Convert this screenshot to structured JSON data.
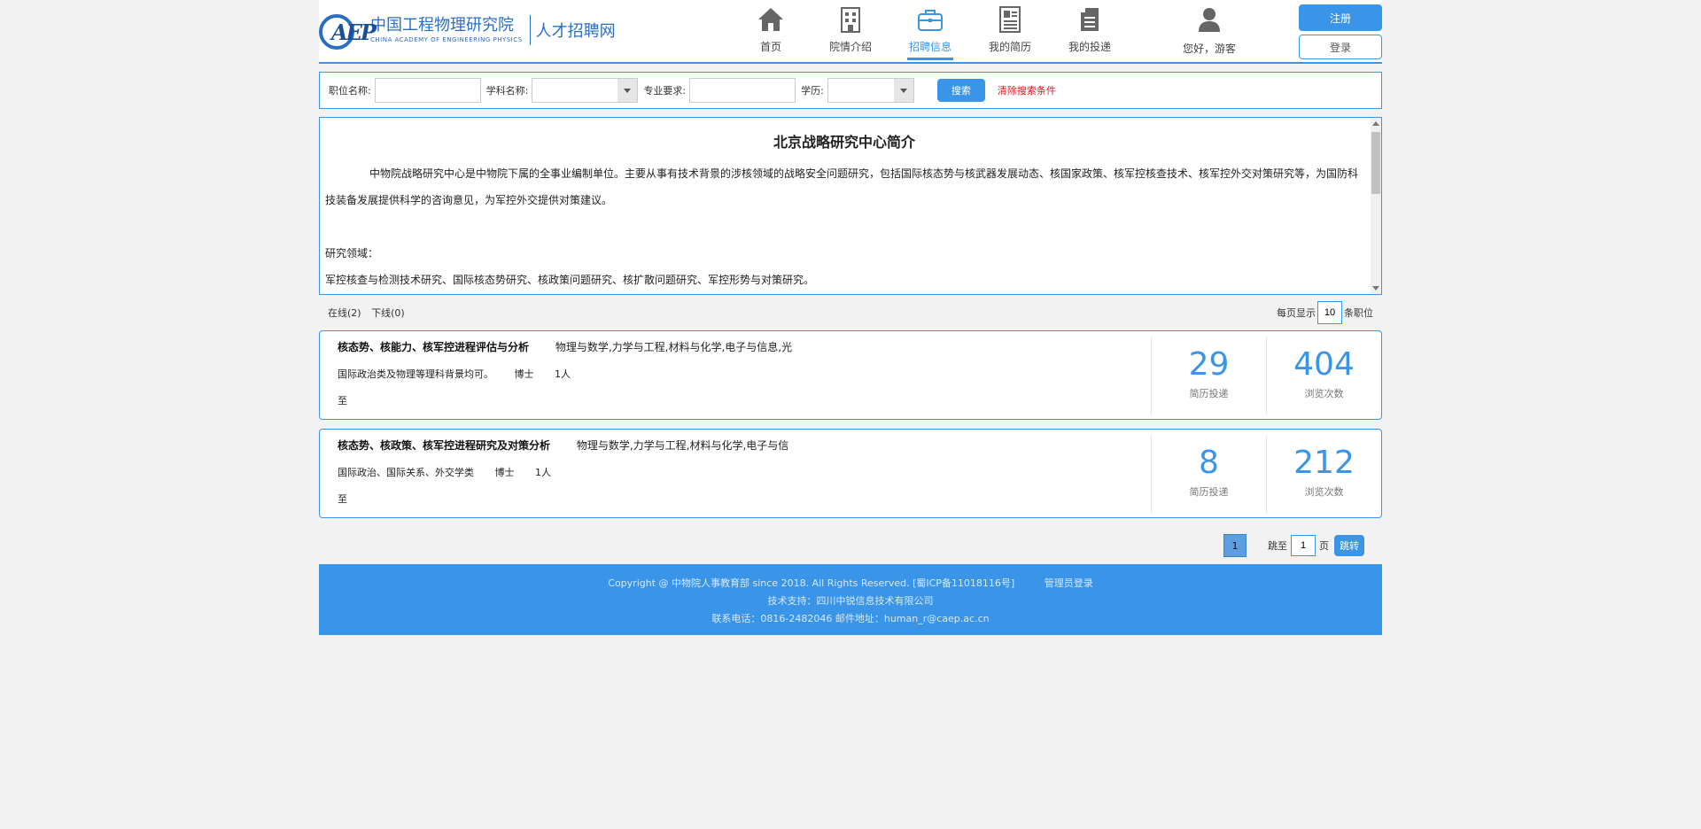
{
  "header": {
    "logo_mark": "AEP",
    "logo_cn": "中国工程物理研究院",
    "logo_en": "CHINA ACADEMY OF ENGINEERING PHYSICS",
    "logo_sub": "人才招聘网",
    "nav": [
      {
        "label": "首页",
        "icon": "home-icon"
      },
      {
        "label": "院情介绍",
        "icon": "building-icon"
      },
      {
        "label": "招聘信息",
        "icon": "briefcase-icon",
        "active": true
      },
      {
        "label": "我的简历",
        "icon": "resume-icon"
      },
      {
        "label": "我的投递",
        "icon": "document-icon"
      }
    ],
    "user_greeting": "您好，游客",
    "register_label": "注册",
    "login_label": "登录"
  },
  "search": {
    "position_label": "职位名称:",
    "subject_label": "学科名称:",
    "major_label": "专业要求:",
    "degree_label": "学历:",
    "search_button": "搜索",
    "clear_label": "清除搜索条件"
  },
  "intro": {
    "title": "北京战略研究中心简介",
    "paragraph": "中物院战略研究中心是中物院下属的全事业编制单位。主要从事有技术背景的涉核领域的战略安全问题研究，包括国际核态势与核武器发展动态、核国家政策、核军控核查技术、核军控外交对策研究等，为国防科技装备发展提供科学的咨询意见，为军控外交提供对策建议。",
    "field_label": "研究领域：",
    "field_text": "军控核查与检测技术研究、国际核态势研究、核政策问题研究、核扩散问题研究、军控形势与对策研究。"
  },
  "status": {
    "online": "在线(2)",
    "offline": "下线(0)",
    "per_page_prefix": "每页显示",
    "per_page_value": "10",
    "per_page_suffix": "条职位"
  },
  "jobs": [
    {
      "title": "核态势、核能力、核军控进程评估与分析",
      "majors": "物理与数学,力学与工程,材料与化学,电子与信息,光",
      "requirement": "国际政治类及物理等理科背景均可。",
      "degree": "博士",
      "count": "1人",
      "date": "至",
      "applications": "29",
      "applications_label": "简历投递",
      "views": "404",
      "views_label": "浏览次数"
    },
    {
      "title": "核态势、核政策、核军控进程研究及对策分析",
      "majors": "物理与数学,力学与工程,材料与化学,电子与信",
      "requirement": "国际政治、国际关系、外交学类",
      "degree": "博士",
      "count": "1人",
      "date": "至",
      "applications": "8",
      "applications_label": "简历投递",
      "views": "212",
      "views_label": "浏览次数"
    }
  ],
  "pager": {
    "current": "1",
    "jump_prefix": "跳至",
    "jump_value": "1",
    "jump_suffix": "页",
    "go_label": "跳转"
  },
  "footer": {
    "copyright": "Copyright @ 中物院人事教育部 since 2018. All Rights Reserved.  [蜀ICP备11018116号]",
    "admin": "管理员登录",
    "support": "技术支持：四川中锐信息技术有限公司",
    "contact": "联系电话：0816-2482046 邮件地址：human_r@caep.ac.cn"
  }
}
